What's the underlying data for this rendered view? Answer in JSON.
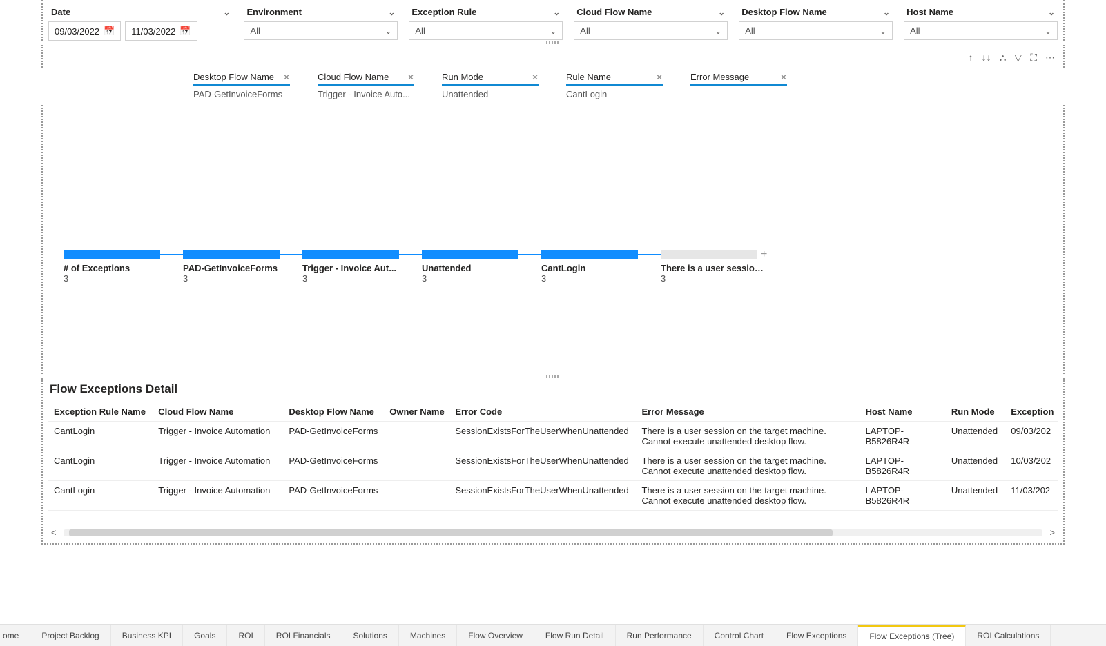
{
  "filters": {
    "date": {
      "label": "Date",
      "from": "09/03/2022",
      "to": "11/03/2022"
    },
    "environment": {
      "label": "Environment",
      "value": "All"
    },
    "exceptionRule": {
      "label": "Exception Rule",
      "value": "All"
    },
    "cloudFlowName": {
      "label": "Cloud Flow Name",
      "value": "All"
    },
    "desktopFlowName": {
      "label": "Desktop Flow Name",
      "value": "All"
    },
    "hostName": {
      "label": "Host Name",
      "value": "All"
    }
  },
  "crumbs": [
    {
      "label": "Desktop Flow Name",
      "value": "PAD-GetInvoiceForms"
    },
    {
      "label": "Cloud Flow Name",
      "value": "Trigger - Invoice Auto..."
    },
    {
      "label": "Run Mode",
      "value": "Unattended"
    },
    {
      "label": "Rule Name",
      "value": "CantLogin"
    },
    {
      "label": "Error Message",
      "value": ""
    }
  ],
  "tree": [
    {
      "label": "# of Exceptions",
      "count": "3"
    },
    {
      "label": "PAD-GetInvoiceForms",
      "count": "3"
    },
    {
      "label": "Trigger - Invoice Aut...",
      "count": "3"
    },
    {
      "label": "Unattended",
      "count": "3"
    },
    {
      "label": "CantLogin",
      "count": "3"
    },
    {
      "label": "There is a user session ...",
      "count": "3"
    }
  ],
  "detail": {
    "title": "Flow Exceptions Detail",
    "columns": [
      "Exception Rule Name",
      "Cloud Flow Name",
      "Desktop Flow Name",
      "Owner Name",
      "Error Code",
      "Error Message",
      "Host Name",
      "Run Mode",
      "Exception"
    ],
    "rows": [
      {
        "rule": "CantLogin",
        "cloud": "Trigger - Invoice Automation",
        "desktop": "PAD-GetInvoiceForms",
        "owner": "",
        "code": "SessionExistsForTheUserWhenUnattended",
        "msg": "There is a user session on the target machine. Cannot execute unattended desktop flow.",
        "host": "LAPTOP-B5826R4R",
        "mode": "Unattended",
        "exc": "09/03/202"
      },
      {
        "rule": "CantLogin",
        "cloud": "Trigger - Invoice Automation",
        "desktop": "PAD-GetInvoiceForms",
        "owner": "",
        "code": "SessionExistsForTheUserWhenUnattended",
        "msg": "There is a user session on the target machine. Cannot execute unattended desktop flow.",
        "host": "LAPTOP-B5826R4R",
        "mode": "Unattended",
        "exc": "10/03/202"
      },
      {
        "rule": "CantLogin",
        "cloud": "Trigger - Invoice Automation",
        "desktop": "PAD-GetInvoiceForms",
        "owner": "",
        "code": "SessionExistsForTheUserWhenUnattended",
        "msg": "There is a user session on the target machine. Cannot execute unattended desktop flow.",
        "host": "LAPTOP-B5826R4R",
        "mode": "Unattended",
        "exc": "11/03/202"
      }
    ]
  },
  "tabs": {
    "partialLeft": "ome",
    "items": [
      "Project Backlog",
      "Business KPI",
      "Goals",
      "ROI",
      "ROI Financials",
      "Solutions",
      "Machines",
      "Flow Overview",
      "Flow Run Detail",
      "Run Performance",
      "Control Chart",
      "Flow Exceptions",
      "Flow Exceptions (Tree)",
      "ROI Calculations"
    ],
    "active": "Flow Exceptions (Tree)"
  }
}
